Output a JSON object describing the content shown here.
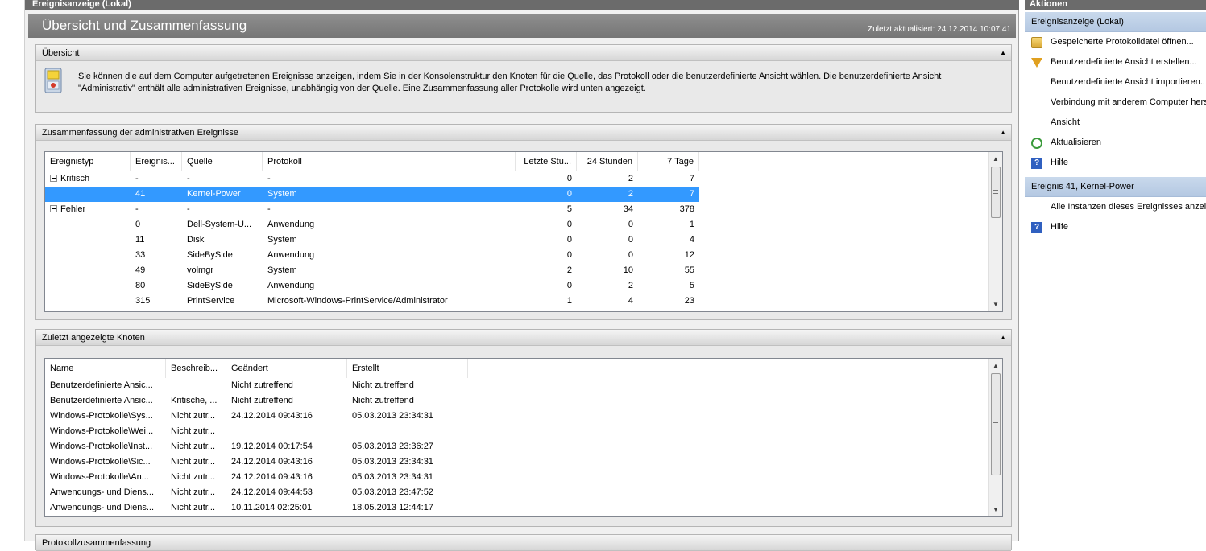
{
  "window": {
    "title": "Ereignisanzeige (Lokal)"
  },
  "header": {
    "title": "Übersicht und Zusammenfassung",
    "updated": "Zuletzt aktualisiert: 24.12.2014 10:07:41"
  },
  "overview": {
    "title": "Übersicht",
    "text": "Sie können die auf dem Computer aufgetretenen Ereignisse anzeigen, indem Sie in der Konsolenstruktur den Knoten für die Quelle, das Protokoll oder die benutzerdefinierte Ansicht wählen. Die benutzerdefinierte Ansicht \"Administrativ\" enthält alle administrativen Ereignisse, unabhängig von der Quelle. Eine Zusammenfassung aller Protokolle wird unten angezeigt."
  },
  "admin_summary": {
    "title": "Zusammenfassung der administrativen Ereignisse",
    "columns": [
      "Ereignistyp",
      "Ereignis...",
      "Quelle",
      "Protokoll",
      "Letzte Stu...",
      "24 Stunden",
      "7 Tage"
    ],
    "rows": [
      {
        "type": "Kritisch",
        "id": "-",
        "source": "-",
        "log": "-",
        "hour": "0",
        "day": "2",
        "week": "7",
        "group": true
      },
      {
        "type": "",
        "id": "41",
        "source": "Kernel-Power",
        "log": "System",
        "hour": "0",
        "day": "2",
        "week": "7",
        "selected": true
      },
      {
        "type": "Fehler",
        "id": "-",
        "source": "-",
        "log": "-",
        "hour": "5",
        "day": "34",
        "week": "378",
        "group": true
      },
      {
        "type": "",
        "id": "0",
        "source": "Dell-System-U...",
        "log": "Anwendung",
        "hour": "0",
        "day": "0",
        "week": "1"
      },
      {
        "type": "",
        "id": "11",
        "source": "Disk",
        "log": "System",
        "hour": "0",
        "day": "0",
        "week": "4"
      },
      {
        "type": "",
        "id": "33",
        "source": "SideBySide",
        "log": "Anwendung",
        "hour": "0",
        "day": "0",
        "week": "12"
      },
      {
        "type": "",
        "id": "49",
        "source": "volmgr",
        "log": "System",
        "hour": "2",
        "day": "10",
        "week": "55"
      },
      {
        "type": "",
        "id": "80",
        "source": "SideBySide",
        "log": "Anwendung",
        "hour": "0",
        "day": "2",
        "week": "5"
      },
      {
        "type": "",
        "id": "315",
        "source": "PrintService",
        "log": "Microsoft-Windows-PrintService/Administrator",
        "hour": "1",
        "day": "4",
        "week": "23"
      }
    ]
  },
  "recent_nodes": {
    "title": "Zuletzt angezeigte Knoten",
    "columns": [
      "Name",
      "Beschreib...",
      "Geändert",
      "Erstellt"
    ],
    "rows": [
      {
        "name": "Benutzerdefinierte Ansic...",
        "desc": "",
        "changed": "Nicht zutreffend",
        "created": "Nicht zutreffend"
      },
      {
        "name": "Benutzerdefinierte Ansic...",
        "desc": "Kritische, ...",
        "changed": "Nicht zutreffend",
        "created": "Nicht zutreffend"
      },
      {
        "name": "Windows-Protokolle\\Sys...",
        "desc": "Nicht zutr...",
        "changed": "24.12.2014 09:43:16",
        "created": "05.03.2013 23:34:31"
      },
      {
        "name": "Windows-Protokolle\\Wei...",
        "desc": "Nicht zutr...",
        "changed": "",
        "created": ""
      },
      {
        "name": "Windows-Protokolle\\Inst...",
        "desc": "Nicht zutr...",
        "changed": "19.12.2014 00:17:54",
        "created": "05.03.2013 23:36:27"
      },
      {
        "name": "Windows-Protokolle\\Sic...",
        "desc": "Nicht zutr...",
        "changed": "24.12.2014 09:43:16",
        "created": "05.03.2013 23:34:31"
      },
      {
        "name": "Windows-Protokolle\\An...",
        "desc": "Nicht zutr...",
        "changed": "24.12.2014 09:43:16",
        "created": "05.03.2013 23:34:31"
      },
      {
        "name": "Anwendungs- und Diens...",
        "desc": "Nicht zutr...",
        "changed": "24.12.2014 09:44:53",
        "created": "05.03.2013 23:47:52"
      },
      {
        "name": "Anwendungs- und Diens...",
        "desc": "Nicht zutr...",
        "changed": "10.11.2014 02:25:01",
        "created": "18.05.2013 12:44:17"
      }
    ]
  },
  "log_summary": {
    "title": "Protokollzusammenfassung"
  },
  "actions": {
    "title": "Aktionen",
    "section1": "Ereignisanzeige (Lokal)",
    "items1": [
      {
        "label": "Gespeicherte Protokolldatei öffnen...",
        "icon": "folder-open-icon"
      },
      {
        "label": "Benutzerdefinierte Ansicht erstellen...",
        "icon": "filter-icon"
      },
      {
        "label": "Benutzerdefinierte Ansicht importieren...",
        "icon": ""
      },
      {
        "label": "Verbindung mit anderem Computer herstellen...",
        "icon": ""
      },
      {
        "label": "Ansicht",
        "icon": ""
      },
      {
        "label": "Aktualisieren",
        "icon": "refresh-icon"
      },
      {
        "label": "Hilfe",
        "icon": "help-icon"
      }
    ],
    "section2": "Ereignis 41, Kernel-Power",
    "items2": [
      {
        "label": "Alle Instanzen dieses Ereignisses anzeigen...",
        "icon": ""
      },
      {
        "label": "Hilfe",
        "icon": "help-icon"
      }
    ]
  }
}
